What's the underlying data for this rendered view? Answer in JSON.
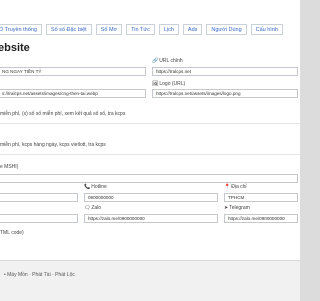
{
  "nav": {
    "items": [
      "Ổ Truyền thống",
      "Sổ số Đặc biệt",
      "Sổ Mơ",
      "Tin Tức",
      "Lịch",
      "Ads",
      "Người Dùng",
      "Cấu hình"
    ]
  },
  "page": {
    "heading": "ebsite"
  },
  "fields": {
    "site_name_value": "NG NGAY TIỀN TỶ",
    "url_label": "URL chính",
    "url_value": "https://tralcps.net",
    "logo_path_value": "s://tralcps.net/assets/images/cng-then-tai.webp",
    "logo_label": "Logo (URL)",
    "logo_value": "https://tralcps.net/assets/images/logo.png",
    "description_text": "miễn phí, (x) số số miễn phí, xem kết quả số số, tra kcps",
    "keywords_text": "miễn phí, kcps hàng ngày, kcps vietlott, tra kcps",
    "tax_label": "e MSHI)",
    "hotline_label": "Hotline",
    "address_label": "Địa chỉ",
    "hotline_value": "0900000000",
    "address_value": "TPHCM",
    "zalo_label": "Zalo",
    "telegram_label": "Telegram",
    "zalo_value": "https://zalo.me/0900000000",
    "telegram_value": "https://zalo.me/0900000000",
    "html_code_label": "TML code)"
  },
  "footer": {
    "breadcrumb": "• Máy Mồn · Phát Tài · Phát Lộc"
  }
}
